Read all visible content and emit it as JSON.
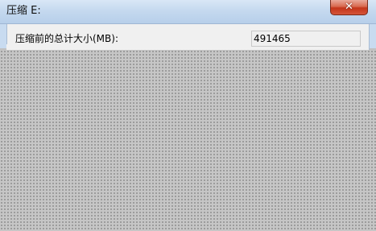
{
  "window": {
    "title": "压缩 E:",
    "close_glyph": "✕"
  },
  "content": {
    "size_label": "压缩前的总计大小(MB):",
    "size_value": "491465"
  },
  "overlay": {
    "pattern": "dither",
    "color": "#c6c6c6"
  }
}
